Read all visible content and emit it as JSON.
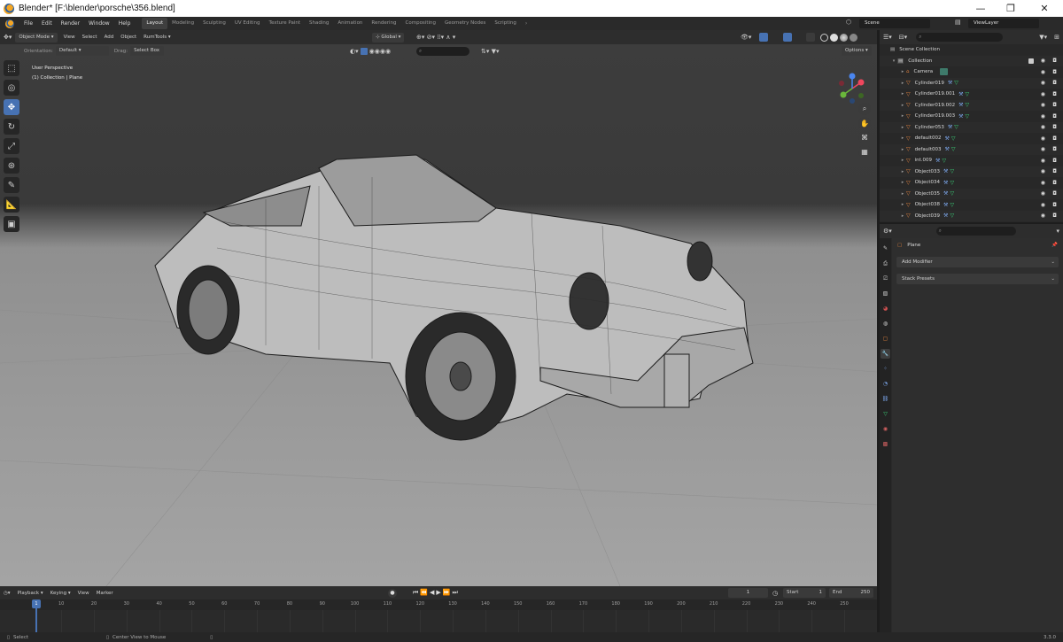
{
  "window": {
    "title": "Blender* [F:\\blender\\porsche\\356.blend]",
    "minimize": "—",
    "restore": "❐",
    "close": "✕"
  },
  "menu": {
    "items": [
      "File",
      "Edit",
      "Render",
      "Window",
      "Help"
    ],
    "workspaces": [
      "Layout",
      "Modeling",
      "Sculpting",
      "UV Editing",
      "Texture Paint",
      "Shading",
      "Animation",
      "Rendering",
      "Compositing",
      "Geometry Nodes",
      "Scripting"
    ],
    "active_workspace": "Layout",
    "scene": "Scene",
    "view_layer": "ViewLayer"
  },
  "viewport_header": {
    "mode": "Object Mode",
    "items": [
      "View",
      "Select",
      "Add",
      "Object",
      "RumTools"
    ],
    "transform_orientation": "Global",
    "options": "Options",
    "orientation_label": "Orientation:",
    "orientation_value": "Default",
    "drag_label": "Drag:",
    "drag_value": "Select Box"
  },
  "viewport": {
    "perspective": "User Perspective",
    "collection_info": "(1) Collection | Plane"
  },
  "outliner": {
    "scene_collection": "Scene Collection",
    "collection": "Collection",
    "objects": [
      {
        "name": "Camera",
        "type": "camera"
      },
      {
        "name": "Cylinder019",
        "type": "mesh"
      },
      {
        "name": "Cylinder019.001",
        "type": "mesh"
      },
      {
        "name": "Cylinder019.002",
        "type": "mesh"
      },
      {
        "name": "Cylinder019.003",
        "type": "mesh"
      },
      {
        "name": "Cylinder053",
        "type": "mesh"
      },
      {
        "name": "default002",
        "type": "mesh"
      },
      {
        "name": "default003",
        "type": "mesh"
      },
      {
        "name": "int.009",
        "type": "mesh"
      },
      {
        "name": "Object033",
        "type": "mesh"
      },
      {
        "name": "Object034",
        "type": "mesh"
      },
      {
        "name": "Object035",
        "type": "mesh"
      },
      {
        "name": "Object038",
        "type": "mesh"
      },
      {
        "name": "Object039",
        "type": "mesh"
      }
    ]
  },
  "properties": {
    "object_name": "Plane",
    "add_modifier": "Add Modifier",
    "stack_presets": "Stack Presets"
  },
  "timeline": {
    "menu": [
      "Playback",
      "Keying",
      "View",
      "Marker"
    ],
    "current_frame": "1",
    "start_label": "Start",
    "start": "1",
    "end_label": "End",
    "end": "250",
    "ticks": [
      "10",
      "20",
      "30",
      "40",
      "50",
      "60",
      "70",
      "80",
      "90",
      "100",
      "110",
      "120",
      "130",
      "140",
      "150",
      "160",
      "170",
      "180",
      "190",
      "200",
      "210",
      "220",
      "230",
      "240",
      "250"
    ],
    "playhead": "1"
  },
  "status": {
    "select": "Select",
    "center_view": "Center View to Mouse",
    "version": "3.3.0"
  },
  "colors": {
    "accent": "#4772b3",
    "mesh_icon": "#e6843e",
    "data_icon": "#3bd67a"
  }
}
